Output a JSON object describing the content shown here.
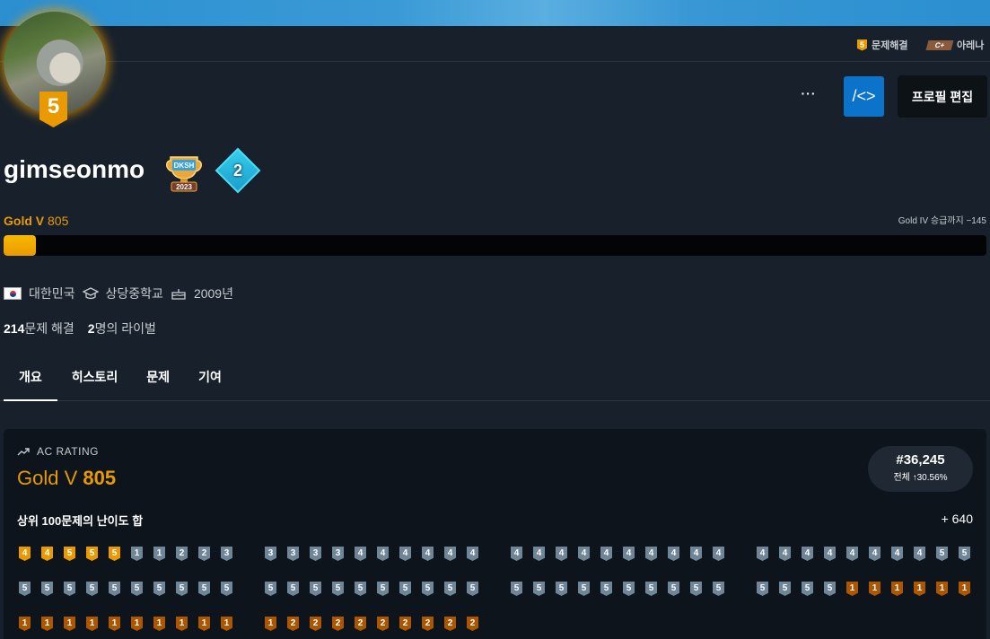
{
  "topbar": {
    "solved_tier": "5",
    "solved_label": "문제해결",
    "arena_tier": "C+",
    "arena_label": "아레나"
  },
  "profile": {
    "avatar_tier": "5",
    "username": "gimseonmo",
    "trophy_text": "DKSH",
    "trophy_year": "2023",
    "class_level": "2",
    "more_label": "···",
    "code_label": "/<>",
    "edit_label": "프로필 편집"
  },
  "rating": {
    "tier": "Gold V",
    "value": "805",
    "promotion": "Gold IV 승급까지 −145",
    "progress": 0.033
  },
  "info": {
    "country": "대한민국",
    "school": "상당중학교",
    "birth_year": "2009년"
  },
  "stats": {
    "solved_count": "214",
    "solved_label": "문제 해결",
    "rival_count": "2",
    "rival_label": "명의 라이벌"
  },
  "tabs": [
    "개요",
    "히스토리",
    "문제",
    "기여"
  ],
  "ac": {
    "label": "AC RATING",
    "tier": "Gold V",
    "value": "805",
    "rank": "#36,245",
    "rank_sub": "전체 ↑30.56%",
    "sum_label": "상위 100문제의 난이도 합",
    "sum_value": "+ 640"
  },
  "problem_rows": [
    [
      [
        [
          "g",
          "4"
        ],
        [
          "g",
          "4"
        ],
        [
          "g",
          "5"
        ],
        [
          "g",
          "5"
        ],
        [
          "g",
          "5"
        ],
        [
          "s",
          "1"
        ],
        [
          "s",
          "1"
        ],
        [
          "s",
          "2"
        ],
        [
          "s",
          "2"
        ],
        [
          "s",
          "3"
        ]
      ],
      [
        [
          "s",
          "3"
        ],
        [
          "s",
          "3"
        ],
        [
          "s",
          "3"
        ],
        [
          "s",
          "3"
        ],
        [
          "s",
          "4"
        ],
        [
          "s",
          "4"
        ],
        [
          "s",
          "4"
        ],
        [
          "s",
          "4"
        ],
        [
          "s",
          "4"
        ],
        [
          "s",
          "4"
        ]
      ],
      [
        [
          "s",
          "4"
        ],
        [
          "s",
          "4"
        ],
        [
          "s",
          "4"
        ],
        [
          "s",
          "4"
        ],
        [
          "s",
          "4"
        ],
        [
          "s",
          "4"
        ],
        [
          "s",
          "4"
        ],
        [
          "s",
          "4"
        ],
        [
          "s",
          "4"
        ],
        [
          "s",
          "4"
        ]
      ],
      [
        [
          "s",
          "4"
        ],
        [
          "s",
          "4"
        ],
        [
          "s",
          "4"
        ],
        [
          "s",
          "4"
        ],
        [
          "s",
          "4"
        ],
        [
          "s",
          "4"
        ],
        [
          "s",
          "4"
        ],
        [
          "s",
          "4"
        ],
        [
          "s",
          "5"
        ],
        [
          "s",
          "5"
        ]
      ]
    ],
    [
      [
        [
          "s",
          "5"
        ],
        [
          "s",
          "5"
        ],
        [
          "s",
          "5"
        ],
        [
          "s",
          "5"
        ],
        [
          "s",
          "5"
        ],
        [
          "s",
          "5"
        ],
        [
          "s",
          "5"
        ],
        [
          "s",
          "5"
        ],
        [
          "s",
          "5"
        ],
        [
          "s",
          "5"
        ]
      ],
      [
        [
          "s",
          "5"
        ],
        [
          "s",
          "5"
        ],
        [
          "s",
          "5"
        ],
        [
          "s",
          "5"
        ],
        [
          "s",
          "5"
        ],
        [
          "s",
          "5"
        ],
        [
          "s",
          "5"
        ],
        [
          "s",
          "5"
        ],
        [
          "s",
          "5"
        ],
        [
          "s",
          "5"
        ]
      ],
      [
        [
          "s",
          "5"
        ],
        [
          "s",
          "5"
        ],
        [
          "s",
          "5"
        ],
        [
          "s",
          "5"
        ],
        [
          "s",
          "5"
        ],
        [
          "s",
          "5"
        ],
        [
          "s",
          "5"
        ],
        [
          "s",
          "5"
        ],
        [
          "s",
          "5"
        ],
        [
          "s",
          "5"
        ]
      ],
      [
        [
          "s",
          "5"
        ],
        [
          "s",
          "5"
        ],
        [
          "s",
          "5"
        ],
        [
          "s",
          "5"
        ],
        [
          "b",
          "1"
        ],
        [
          "b",
          "1"
        ],
        [
          "b",
          "1"
        ],
        [
          "b",
          "1"
        ],
        [
          "b",
          "1"
        ],
        [
          "b",
          "1"
        ]
      ]
    ],
    [
      [
        [
          "b",
          "1"
        ],
        [
          "b",
          "1"
        ],
        [
          "b",
          "1"
        ],
        [
          "b",
          "1"
        ],
        [
          "b",
          "1"
        ],
        [
          "b",
          "1"
        ],
        [
          "b",
          "1"
        ],
        [
          "b",
          "1"
        ],
        [
          "b",
          "1"
        ],
        [
          "b",
          "1"
        ]
      ],
      [
        [
          "b",
          "1"
        ],
        [
          "b",
          "2"
        ],
        [
          "b",
          "2"
        ],
        [
          "b",
          "2"
        ],
        [
          "b",
          "2"
        ],
        [
          "b",
          "2"
        ],
        [
          "b",
          "2"
        ],
        [
          "b",
          "2"
        ],
        [
          "b",
          "2"
        ],
        [
          "b",
          "2"
        ]
      ]
    ]
  ]
}
